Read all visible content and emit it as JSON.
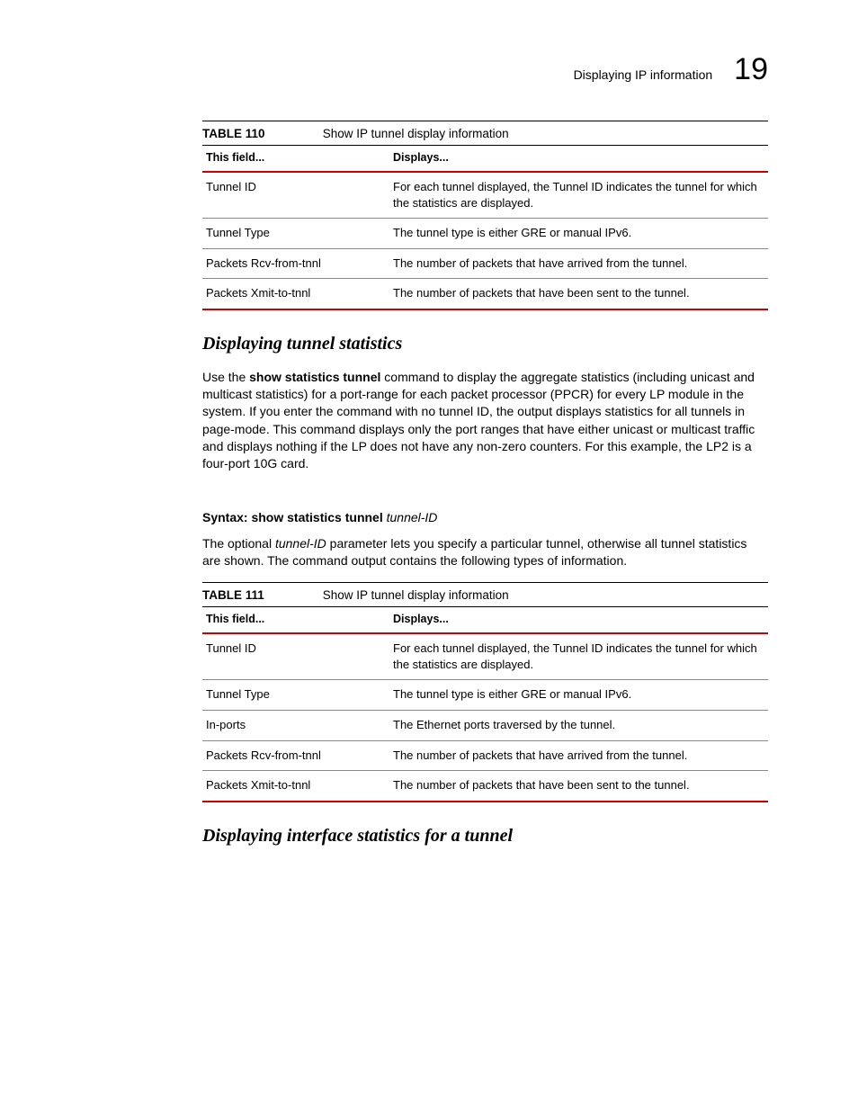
{
  "header": {
    "title": "Displaying IP information",
    "chapter": "19"
  },
  "table110": {
    "label": "TABLE 110",
    "caption": "Show IP tunnel display information",
    "head_field": "This field...",
    "head_displays": "Displays...",
    "rows": [
      {
        "field": "Tunnel ID",
        "displays": "For each tunnel displayed, the Tunnel ID indicates the tunnel for which the statistics are displayed."
      },
      {
        "field": "Tunnel Type",
        "displays": "The tunnel type is either GRE or manual IPv6."
      },
      {
        "field": "Packets Rcv-from-tnnl",
        "displays": "The number of packets that have arrived from the tunnel."
      },
      {
        "field": "Packets Xmit-to-tnnl",
        "displays": "The number of packets that have been sent to the tunnel."
      }
    ]
  },
  "section1": {
    "heading": "Displaying tunnel statistics",
    "para1_a": "Use the ",
    "para1_bold": "show statistics tunnel",
    "para1_b": " command to display the aggregate statistics (including unicast and multicast statistics) for a port-range for each packet processor (PPCR) for every LP module in the system. If you enter the command with no tunnel ID, the output displays statistics for all tunnels in page-mode. This command displays only the port ranges that have either unicast or multicast traffic and displays nothing if the LP does not have any non-zero counters. For this example, the LP2 is a four-port 10G card.",
    "syntax_label": "Syntax: ",
    "syntax_cmd": "show statistics tunnel ",
    "syntax_arg": "tunnel-ID",
    "para2_a": "The optional ",
    "para2_italic": "tunnel-ID",
    "para2_b": " parameter lets you specify a particular tunnel, otherwise all tunnel statistics are shown. The command output contains the following types of information."
  },
  "table111": {
    "label": "TABLE 111",
    "caption": "Show IP tunnel display information",
    "head_field": "This field...",
    "head_displays": "Displays...",
    "rows": [
      {
        "field": "Tunnel ID",
        "displays": "For each tunnel displayed, the Tunnel ID indicates the tunnel for which the statistics are displayed."
      },
      {
        "field": "Tunnel Type",
        "displays": "The tunnel type is either GRE or manual IPv6."
      },
      {
        "field": "In-ports",
        "displays": "The Ethernet ports traversed by the tunnel."
      },
      {
        "field": "Packets Rcv-from-tnnl",
        "displays": "The number of packets that have arrived from the tunnel."
      },
      {
        "field": "Packets Xmit-to-tnnl",
        "displays": "The number of packets that have been sent to the tunnel."
      }
    ]
  },
  "section2": {
    "heading": "Displaying interface statistics for a tunnel"
  }
}
